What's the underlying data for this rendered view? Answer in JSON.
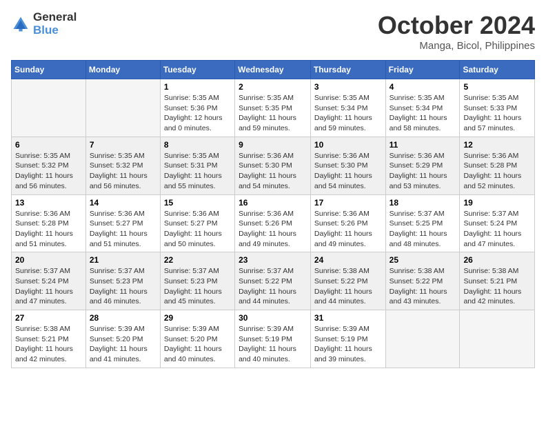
{
  "logo": {
    "general": "General",
    "blue": "Blue"
  },
  "title": "October 2024",
  "location": "Manga, Bicol, Philippines",
  "weekdays": [
    "Sunday",
    "Monday",
    "Tuesday",
    "Wednesday",
    "Thursday",
    "Friday",
    "Saturday"
  ],
  "weeks": [
    [
      {
        "day": "",
        "info": ""
      },
      {
        "day": "",
        "info": ""
      },
      {
        "day": "1",
        "sunrise": "5:35 AM",
        "sunset": "5:36 PM",
        "daylight": "12 hours and 0 minutes."
      },
      {
        "day": "2",
        "sunrise": "5:35 AM",
        "sunset": "5:35 PM",
        "daylight": "11 hours and 59 minutes."
      },
      {
        "day": "3",
        "sunrise": "5:35 AM",
        "sunset": "5:34 PM",
        "daylight": "11 hours and 59 minutes."
      },
      {
        "day": "4",
        "sunrise": "5:35 AM",
        "sunset": "5:34 PM",
        "daylight": "11 hours and 58 minutes."
      },
      {
        "day": "5",
        "sunrise": "5:35 AM",
        "sunset": "5:33 PM",
        "daylight": "11 hours and 57 minutes."
      }
    ],
    [
      {
        "day": "6",
        "sunrise": "5:35 AM",
        "sunset": "5:32 PM",
        "daylight": "11 hours and 56 minutes."
      },
      {
        "day": "7",
        "sunrise": "5:35 AM",
        "sunset": "5:32 PM",
        "daylight": "11 hours and 56 minutes."
      },
      {
        "day": "8",
        "sunrise": "5:35 AM",
        "sunset": "5:31 PM",
        "daylight": "11 hours and 55 minutes."
      },
      {
        "day": "9",
        "sunrise": "5:36 AM",
        "sunset": "5:30 PM",
        "daylight": "11 hours and 54 minutes."
      },
      {
        "day": "10",
        "sunrise": "5:36 AM",
        "sunset": "5:30 PM",
        "daylight": "11 hours and 54 minutes."
      },
      {
        "day": "11",
        "sunrise": "5:36 AM",
        "sunset": "5:29 PM",
        "daylight": "11 hours and 53 minutes."
      },
      {
        "day": "12",
        "sunrise": "5:36 AM",
        "sunset": "5:28 PM",
        "daylight": "11 hours and 52 minutes."
      }
    ],
    [
      {
        "day": "13",
        "sunrise": "5:36 AM",
        "sunset": "5:28 PM",
        "daylight": "11 hours and 51 minutes."
      },
      {
        "day": "14",
        "sunrise": "5:36 AM",
        "sunset": "5:27 PM",
        "daylight": "11 hours and 51 minutes."
      },
      {
        "day": "15",
        "sunrise": "5:36 AM",
        "sunset": "5:27 PM",
        "daylight": "11 hours and 50 minutes."
      },
      {
        "day": "16",
        "sunrise": "5:36 AM",
        "sunset": "5:26 PM",
        "daylight": "11 hours and 49 minutes."
      },
      {
        "day": "17",
        "sunrise": "5:36 AM",
        "sunset": "5:26 PM",
        "daylight": "11 hours and 49 minutes."
      },
      {
        "day": "18",
        "sunrise": "5:37 AM",
        "sunset": "5:25 PM",
        "daylight": "11 hours and 48 minutes."
      },
      {
        "day": "19",
        "sunrise": "5:37 AM",
        "sunset": "5:24 PM",
        "daylight": "11 hours and 47 minutes."
      }
    ],
    [
      {
        "day": "20",
        "sunrise": "5:37 AM",
        "sunset": "5:24 PM",
        "daylight": "11 hours and 47 minutes."
      },
      {
        "day": "21",
        "sunrise": "5:37 AM",
        "sunset": "5:23 PM",
        "daylight": "11 hours and 46 minutes."
      },
      {
        "day": "22",
        "sunrise": "5:37 AM",
        "sunset": "5:23 PM",
        "daylight": "11 hours and 45 minutes."
      },
      {
        "day": "23",
        "sunrise": "5:37 AM",
        "sunset": "5:22 PM",
        "daylight": "11 hours and 44 minutes."
      },
      {
        "day": "24",
        "sunrise": "5:38 AM",
        "sunset": "5:22 PM",
        "daylight": "11 hours and 44 minutes."
      },
      {
        "day": "25",
        "sunrise": "5:38 AM",
        "sunset": "5:22 PM",
        "daylight": "11 hours and 43 minutes."
      },
      {
        "day": "26",
        "sunrise": "5:38 AM",
        "sunset": "5:21 PM",
        "daylight": "11 hours and 42 minutes."
      }
    ],
    [
      {
        "day": "27",
        "sunrise": "5:38 AM",
        "sunset": "5:21 PM",
        "daylight": "11 hours and 42 minutes."
      },
      {
        "day": "28",
        "sunrise": "5:39 AM",
        "sunset": "5:20 PM",
        "daylight": "11 hours and 41 minutes."
      },
      {
        "day": "29",
        "sunrise": "5:39 AM",
        "sunset": "5:20 PM",
        "daylight": "11 hours and 40 minutes."
      },
      {
        "day": "30",
        "sunrise": "5:39 AM",
        "sunset": "5:19 PM",
        "daylight": "11 hours and 40 minutes."
      },
      {
        "day": "31",
        "sunrise": "5:39 AM",
        "sunset": "5:19 PM",
        "daylight": "11 hours and 39 minutes."
      },
      {
        "day": "",
        "info": ""
      },
      {
        "day": "",
        "info": ""
      }
    ]
  ]
}
